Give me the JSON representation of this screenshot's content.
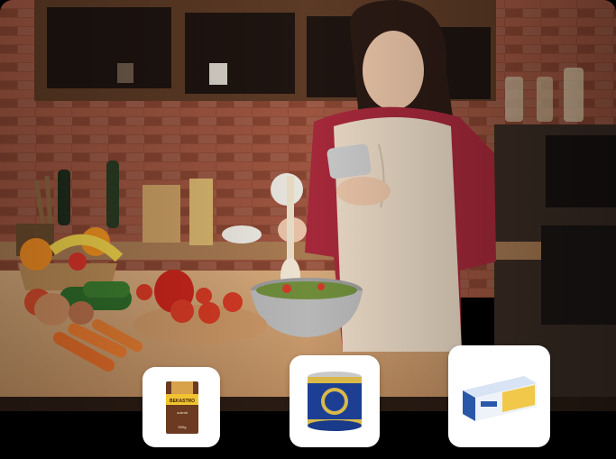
{
  "scene": {
    "products": [
      {
        "name": "coffee-pack",
        "label": "BEKASTRO",
        "sub": "sukmit",
        "weight": "500g"
      },
      {
        "name": "tin-can",
        "label": ""
      },
      {
        "name": "butter-box",
        "label": ""
      }
    ]
  },
  "colors": {
    "brick": "#8f4b36",
    "counter": "#c89a6d",
    "apron": "#e6d6c2",
    "shirt": "#a4283a",
    "can_blue": "#1c3f94",
    "can_gold": "#d8b94a",
    "box_blue": "#2a58a8"
  }
}
